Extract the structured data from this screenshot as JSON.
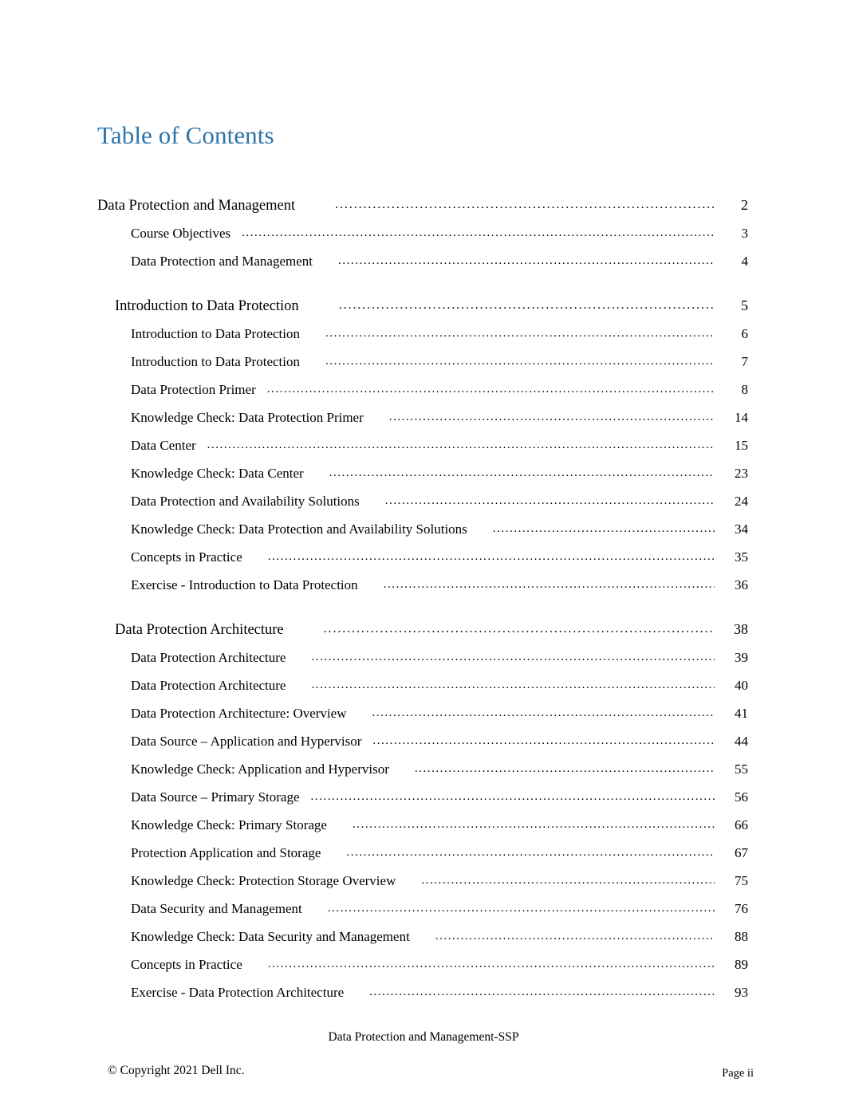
{
  "document": {
    "title": "Table of Contents",
    "title_color": "#2E74A8"
  },
  "toc": {
    "entries": [
      {
        "level": 1,
        "indented": false,
        "gap": "l",
        "label": "Data Protection and Management",
        "page": "2"
      },
      {
        "level": 2,
        "indented": false,
        "gap": "s",
        "label": "Course Objectives",
        "page": "3"
      },
      {
        "level": 2,
        "indented": false,
        "gap": "m",
        "label": "Data Protection and Management",
        "page": "4"
      },
      {
        "level": 1,
        "indented": true,
        "gap": "l",
        "label": "Introduction to Data Protection",
        "page": "5"
      },
      {
        "level": 2,
        "indented": false,
        "gap": "m",
        "label": "Introduction to Data Protection",
        "page": "6"
      },
      {
        "level": 2,
        "indented": false,
        "gap": "m",
        "label": "Introduction to Data Protection",
        "page": "7"
      },
      {
        "level": 2,
        "indented": false,
        "gap": "s",
        "label": "Data Protection Primer",
        "page": "8"
      },
      {
        "level": 2,
        "indented": false,
        "gap": "m",
        "label": "Knowledge Check: Data Protection Primer",
        "page": "14"
      },
      {
        "level": 2,
        "indented": false,
        "gap": "s",
        "label": "Data Center",
        "page": "15"
      },
      {
        "level": 2,
        "indented": false,
        "gap": "m",
        "label": "Knowledge Check: Data Center",
        "page": "23"
      },
      {
        "level": 2,
        "indented": false,
        "gap": "m",
        "label": "Data Protection and Availability Solutions",
        "page": "24"
      },
      {
        "level": 2,
        "indented": false,
        "gap": "m",
        "label": "Knowledge Check: Data Protection and Availability Solutions",
        "page": "34"
      },
      {
        "level": 2,
        "indented": false,
        "gap": "m",
        "label": "Concepts in Practice",
        "page": "35"
      },
      {
        "level": 2,
        "indented": false,
        "gap": "m",
        "label": "Exercise - Introduction to Data Protection",
        "page": "36"
      },
      {
        "level": 1,
        "indented": true,
        "gap": "l",
        "label": "Data Protection Architecture",
        "page": "38"
      },
      {
        "level": 2,
        "indented": false,
        "gap": "m",
        "label": "Data Protection Architecture",
        "page": "39"
      },
      {
        "level": 2,
        "indented": false,
        "gap": "m",
        "label": "Data Protection Architecture",
        "page": "40"
      },
      {
        "level": 2,
        "indented": false,
        "gap": "m",
        "label": "Data Protection Architecture: Overview",
        "page": "41"
      },
      {
        "level": 2,
        "indented": false,
        "gap": "s",
        "label": "Data Source   – Application and Hypervisor",
        "page": "44"
      },
      {
        "level": 2,
        "indented": false,
        "gap": "m",
        "label": "Knowledge Check: Application and Hypervisor",
        "page": "55"
      },
      {
        "level": 2,
        "indented": false,
        "gap": "s",
        "label": "Data Source   – Primary Storage",
        "page": "56"
      },
      {
        "level": 2,
        "indented": false,
        "gap": "m",
        "label": "Knowledge Check: Primary Storage",
        "page": "66"
      },
      {
        "level": 2,
        "indented": false,
        "gap": "m",
        "label": "Protection Application and Storage",
        "page": "67"
      },
      {
        "level": 2,
        "indented": false,
        "gap": "m",
        "label": "Knowledge Check: Protection Storage Overview",
        "page": "75"
      },
      {
        "level": 2,
        "indented": false,
        "gap": "m",
        "label": "Data Security and Management",
        "page": "76"
      },
      {
        "level": 2,
        "indented": false,
        "gap": "m",
        "label": "Knowledge Check: Data Security and Management",
        "page": "88"
      },
      {
        "level": 2,
        "indented": false,
        "gap": "m",
        "label": "Concepts in Practice",
        "page": "89"
      },
      {
        "level": 2,
        "indented": false,
        "gap": "m",
        "label": "Exercise - Data Protection Architecture",
        "page": "93"
      }
    ],
    "leader_char": "."
  },
  "footer": {
    "center": "Data Protection and Management-SSP",
    "copyright": "© Copyright 2021 Dell Inc.",
    "page_label": "Page ii"
  }
}
